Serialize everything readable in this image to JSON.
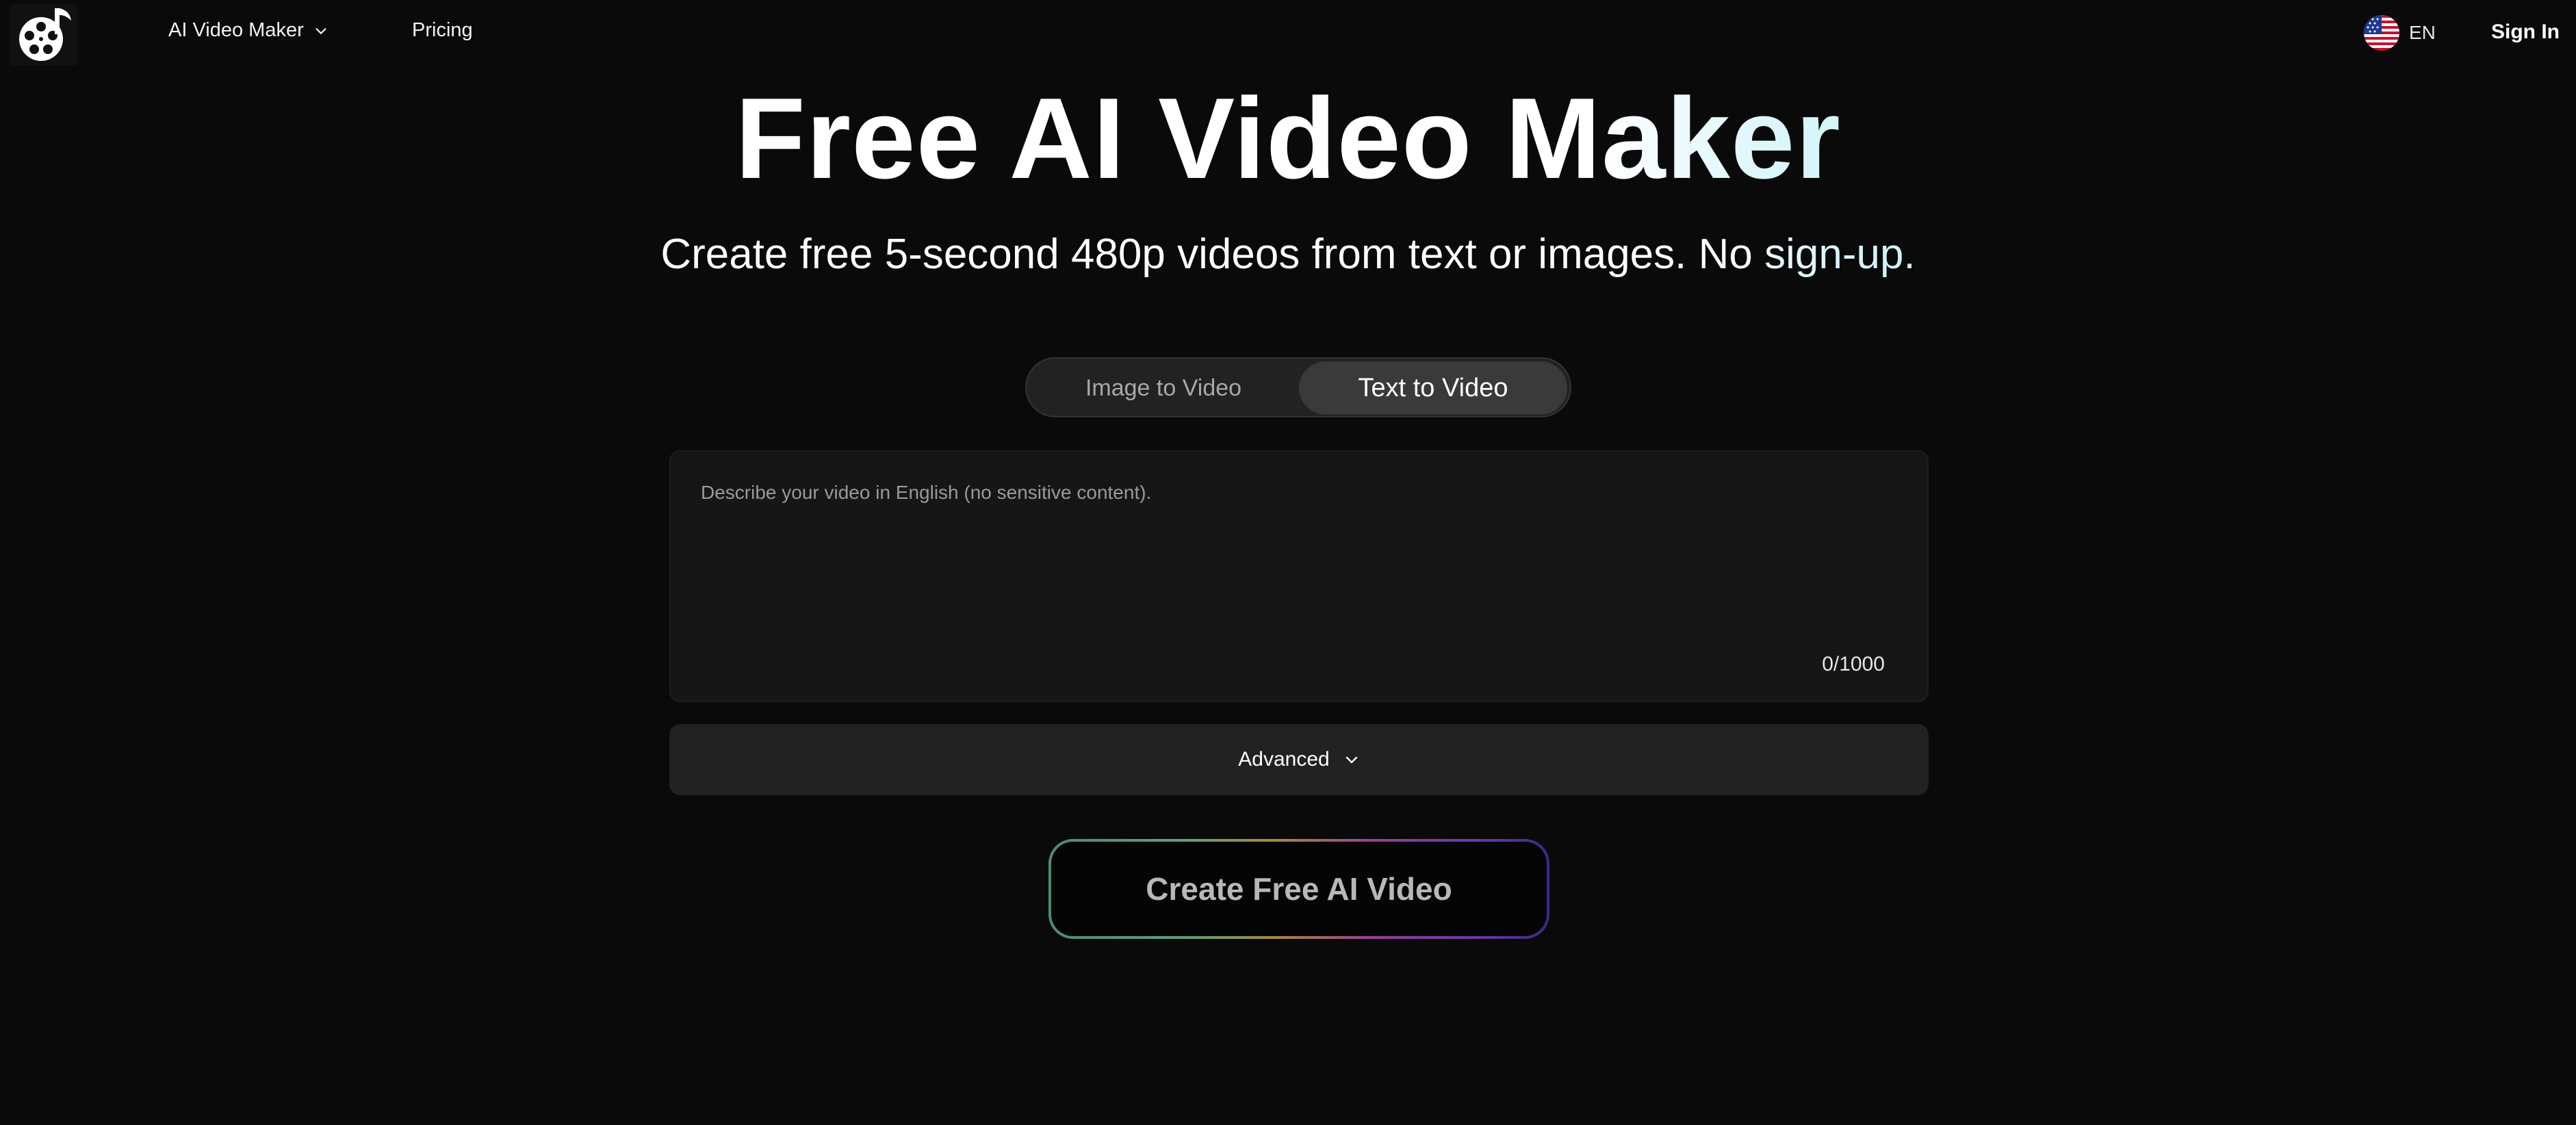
{
  "header": {
    "logo_icon": "film-reel-music-note-icon",
    "nav": {
      "maker_label": "AI Video Maker",
      "pricing_label": "Pricing"
    },
    "language": {
      "flag_icon": "us-flag-icon",
      "code": "EN"
    },
    "sign_in_label": "Sign In"
  },
  "hero": {
    "title": "Free AI Video Maker",
    "subtitle": "Create free 5-second 480p videos from text or images. No sign-up."
  },
  "tabs": {
    "items": [
      {
        "label": "Image to Video",
        "active": false
      },
      {
        "label": "Text to Video",
        "active": true
      }
    ]
  },
  "prompt": {
    "value": "",
    "placeholder": "Describe your video in English (no sensitive content).",
    "counter": "0/1000"
  },
  "advanced": {
    "label": "Advanced"
  },
  "create_button": {
    "label": "Create Free AI Video"
  },
  "colors": {
    "background": "#0a0a0a",
    "panel": "#161616",
    "advanced_bg": "#222222",
    "tab_active": "#3a3a3a",
    "accent_cyan": "#c9f4f6"
  }
}
